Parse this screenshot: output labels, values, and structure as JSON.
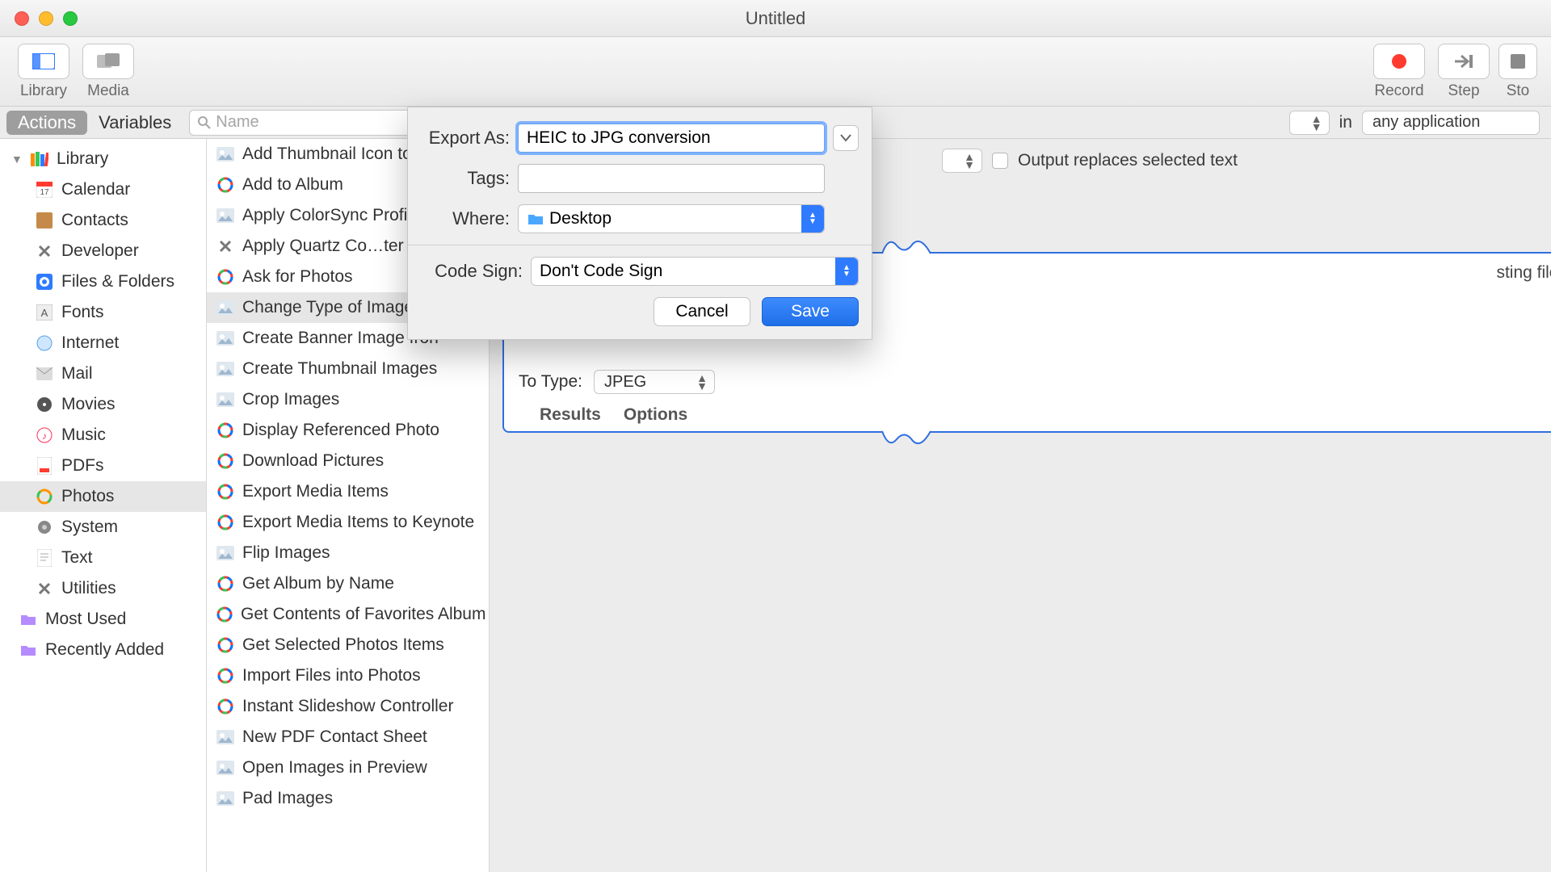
{
  "window": {
    "title": "Untitled"
  },
  "toolbar": {
    "library": "Library",
    "media": "Media",
    "record": "Record",
    "step": "Step",
    "stop": "Sto"
  },
  "tabs": {
    "actions": "Actions",
    "variables": "Variables"
  },
  "search": {
    "placeholder": "Name"
  },
  "workflow_top": {
    "in": "in",
    "app": "any application",
    "output_replaces": "Output replaces selected text"
  },
  "sidebar": {
    "library": "Library",
    "items": [
      "Calendar",
      "Contacts",
      "Developer",
      "Files & Folders",
      "Fonts",
      "Internet",
      "Mail",
      "Movies",
      "Music",
      "PDFs",
      "Photos",
      "System",
      "Text",
      "Utilities"
    ],
    "most_used": "Most Used",
    "recently_added": "Recently Added",
    "selected": "Photos"
  },
  "actions": {
    "items": [
      "Add Thumbnail Icon to Im",
      "Add to Album",
      "Apply ColorSync Profile t",
      "Apply Quartz Co…ter to I",
      "Ask for Photos",
      "Change Type of Images",
      "Create Banner Image fron",
      "Create Thumbnail Images",
      "Crop Images",
      "Display Referenced Photo",
      "Download Pictures",
      "Export Media Items",
      "Export Media Items to Keynote",
      "Flip Images",
      "Get Album by Name",
      "Get Contents of Favorites Album",
      "Get Selected Photos Items",
      "Import Files into Photos",
      "Instant Slideshow Controller",
      "New PDF Contact Sheet",
      "Open Images in Preview",
      "Pad Images"
    ],
    "selected_index": 5
  },
  "card": {
    "existing_files": "sting files",
    "to_type_label": "To Type:",
    "to_type_value": "JPEG",
    "results": "Results",
    "options": "Options"
  },
  "sheet": {
    "export_as_label": "Export As:",
    "export_as_value": "HEIC to JPG conversion",
    "tags_label": "Tags:",
    "tags_value": "",
    "where_label": "Where:",
    "where_value": "Desktop",
    "code_sign_label": "Code Sign:",
    "code_sign_value": "Don't Code Sign",
    "cancel": "Cancel",
    "save": "Save"
  }
}
